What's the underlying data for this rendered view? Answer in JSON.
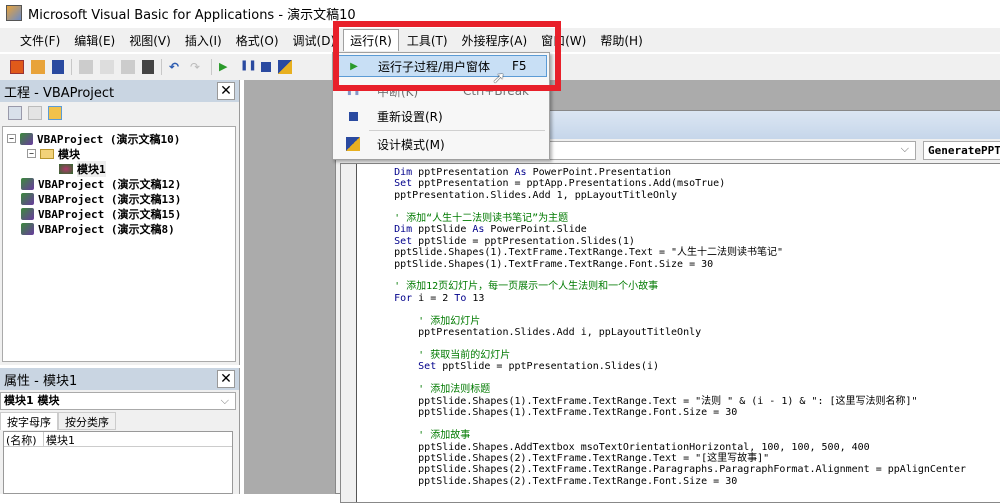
{
  "window": {
    "title": "Microsoft Visual Basic for Applications - 演示文稿10"
  },
  "menubar": [
    "文件(F)",
    "编辑(E)",
    "视图(V)",
    "插入(I)",
    "格式(O)",
    "调试(D)",
    "运行(R)",
    "工具(T)",
    "外接程序(A)",
    "窗口(W)",
    "帮助(H)"
  ],
  "run_menu": {
    "items": [
      {
        "label": "运行子过程/用户窗体",
        "shortcut": "F5",
        "icon": "play-icon"
      },
      {
        "label": "中断(K)",
        "shortcut": "Ctrl+Break",
        "icon": "pause-icon"
      },
      {
        "label": "重新设置(R)",
        "shortcut": "",
        "icon": "stop-icon"
      },
      {
        "label": "设计模式(M)",
        "shortcut": "",
        "icon": "design-mode-icon"
      }
    ]
  },
  "project_panel": {
    "title": "工程 - VBAProject",
    "tree": {
      "root": "VBAProject (演示文稿10)",
      "folder": "模块",
      "module": "模块1",
      "others": [
        "VBAProject (演示文稿12)",
        "VBAProject (演示文稿13)",
        "VBAProject (演示文稿15)",
        "VBAProject (演示文稿8)"
      ]
    }
  },
  "properties_panel": {
    "title": "属性 - 模块1",
    "object": "模块1 模块",
    "tabs": [
      "按字母序",
      "按分类序"
    ],
    "row": {
      "name": "(名称)",
      "value": "模块1"
    }
  },
  "code_window": {
    "procedure": "GeneratePPT",
    "lines": [
      [
        [
          "kw",
          "    Dim "
        ],
        [
          "tx",
          "pptPresentation "
        ],
        [
          "kw",
          "As "
        ],
        [
          "tx",
          "PowerPoint.Presentation"
        ]
      ],
      [
        [
          "kw",
          "    Set "
        ],
        [
          "tx",
          "pptPresentation = pptApp.Presentations.Add(msoTrue)"
        ]
      ],
      [
        [
          "tx",
          "    pptPresentation.Slides.Add 1, ppLayoutTitleOnly"
        ]
      ],
      [],
      [
        [
          "cm",
          "    ' 添加“人生十二法则读书笔记”为主题"
        ]
      ],
      [
        [
          "kw",
          "    Dim "
        ],
        [
          "tx",
          "pptSlide "
        ],
        [
          "kw",
          "As "
        ],
        [
          "tx",
          "PowerPoint.Slide"
        ]
      ],
      [
        [
          "kw",
          "    Set "
        ],
        [
          "tx",
          "pptSlide = pptPresentation.Slides(1)"
        ]
      ],
      [
        [
          "tx",
          "    pptSlide.Shapes(1).TextFrame.TextRange.Text = \"人生十二法则读书笔记\""
        ]
      ],
      [
        [
          "tx",
          "    pptSlide.Shapes(1).TextFrame.TextRange.Font.Size = 30"
        ]
      ],
      [],
      [
        [
          "cm",
          "    ' 添加12页幻灯片，每一页展示一个人生法则和一个小故事"
        ]
      ],
      [
        [
          "kw",
          "    For "
        ],
        [
          "tx",
          "i = 2 "
        ],
        [
          "kw",
          "To "
        ],
        [
          "tx",
          "13"
        ]
      ],
      [],
      [
        [
          "cm",
          "        ' 添加幻灯片"
        ]
      ],
      [
        [
          "tx",
          "        pptPresentation.Slides.Add i, ppLayoutTitleOnly"
        ]
      ],
      [],
      [
        [
          "cm",
          "        ' 获取当前的幻灯片"
        ]
      ],
      [
        [
          "kw",
          "        Set "
        ],
        [
          "tx",
          "pptSlide = pptPresentation.Slides(i)"
        ]
      ],
      [],
      [
        [
          "cm",
          "        ' 添加法则标题"
        ]
      ],
      [
        [
          "tx",
          "        pptSlide.Shapes(1).TextFrame.TextRange.Text = \"法则 \" & (i - 1) & \": [这里写法则名称]\""
        ]
      ],
      [
        [
          "tx",
          "        pptSlide.Shapes(1).TextFrame.TextRange.Font.Size = 30"
        ]
      ],
      [],
      [
        [
          "cm",
          "        ' 添加故事"
        ]
      ],
      [
        [
          "tx",
          "        pptSlide.Shapes.AddTextbox msoTextOrientationHorizontal, 100, 100, 500, 400"
        ]
      ],
      [
        [
          "tx",
          "        pptSlide.Shapes(2).TextFrame.TextRange.Text = \"[这里写故事]\""
        ]
      ],
      [
        [
          "tx",
          "        pptSlide.Shapes(2).TextFrame.TextRange.Paragraphs.ParagraphFormat.Alignment = ppAlignCenter"
        ]
      ],
      [
        [
          "tx",
          "        pptSlide.Shapes(2).TextFrame.TextRange.Font.Size = 30"
        ]
      ]
    ]
  },
  "colors": {
    "highlight_box": "#e8202a",
    "menu_highlight": "#c8dff5",
    "keyword": "#00008b",
    "comment": "#007a00"
  }
}
